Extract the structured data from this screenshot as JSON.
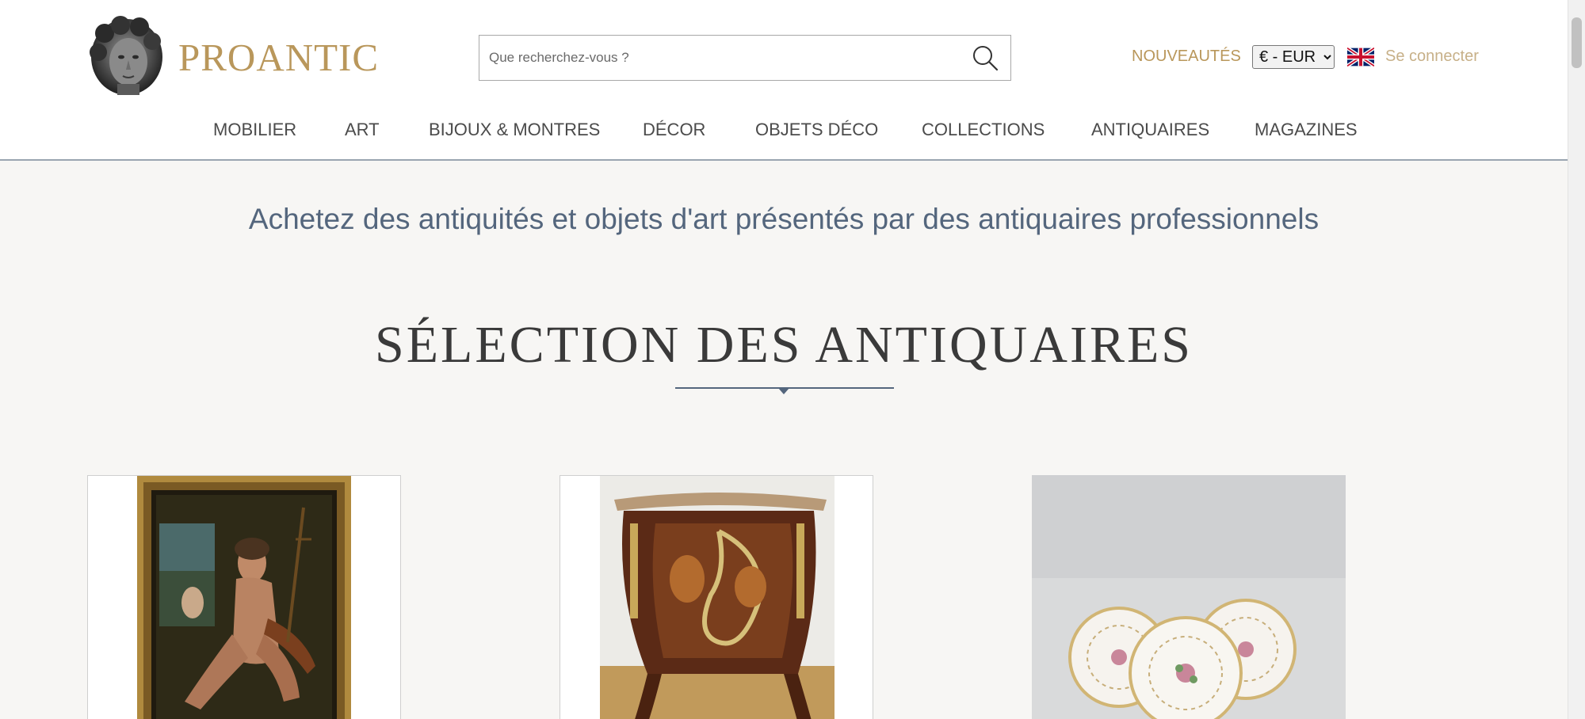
{
  "header": {
    "brand": "PROANTIC",
    "search_placeholder": "Que recherchez-vous ?",
    "new_link": "NOUVEAUTÉS",
    "currency_selected": "€ - EUR",
    "signin": "Se connecter",
    "language_flag": "uk-flag-icon"
  },
  "nav": {
    "items": [
      {
        "label": "MOBILIER"
      },
      {
        "label": "ART"
      },
      {
        "label": "BIJOUX & MONTRES"
      },
      {
        "label": "DÉCOR"
      },
      {
        "label": "OBJETS DÉCO"
      },
      {
        "label": "COLLECTIONS"
      },
      {
        "label": "ANTIQUAIRES"
      },
      {
        "label": "MAGAZINES"
      }
    ]
  },
  "main": {
    "tagline": "Achetez des antiquités et objets d'art présentés par des antiquaires professionnels",
    "section_title": "SÉLECTION DES ANTIQUAIRES"
  },
  "colors": {
    "gold": "#b9975b",
    "slate": "#54667d",
    "background": "#f7f6f4"
  }
}
